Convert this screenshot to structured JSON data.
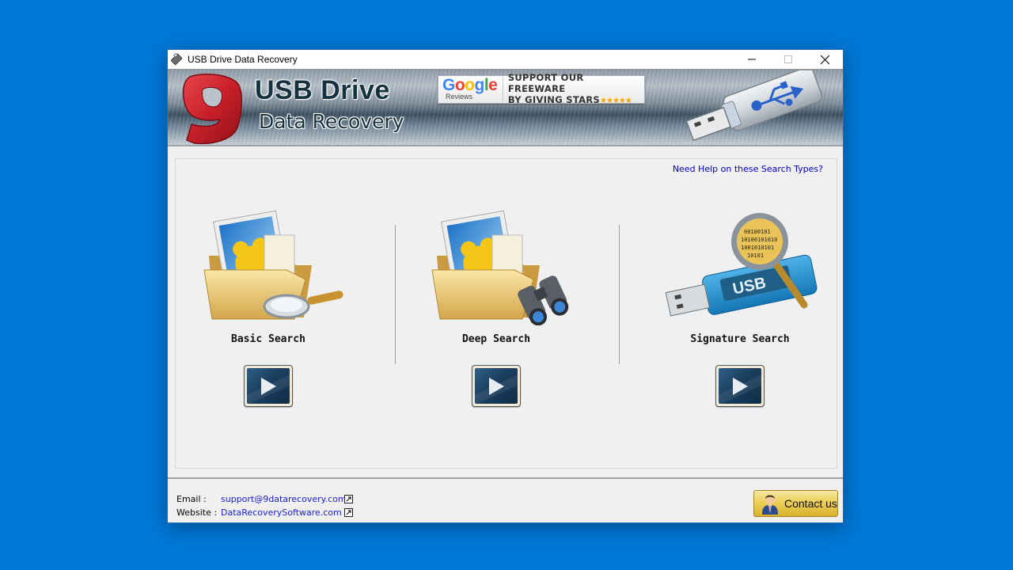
{
  "window": {
    "title": "USB Drive Data Recovery",
    "controls": [
      "minimize",
      "maximize",
      "close"
    ]
  },
  "banner": {
    "logo_glyph": "9",
    "title_line1": "USB Drive",
    "title_line2": "Data Recovery",
    "google_badge": {
      "brand": "Google",
      "brand_sub": "Reviews",
      "line1": "SUPPORT OUR FREEWARE",
      "line2": "BY GIVING STARS",
      "stars": "★★★★★",
      "brand_colors": [
        "#4285f4",
        "#ea4335",
        "#fbbc05",
        "#4285f4",
        "#34a853",
        "#ea4335"
      ]
    }
  },
  "main": {
    "help_link": "Need Help on these Search Types?",
    "options": [
      {
        "label": "Basic Search",
        "icon": "folder-magnifier-icon"
      },
      {
        "label": "Deep Search",
        "icon": "folder-binoculars-icon"
      },
      {
        "label": "Signature Search",
        "icon": "usb-magnifier-icon"
      }
    ]
  },
  "footer": {
    "email_label": "Email :",
    "email_value": "support@9datarecovery.com",
    "website_label": "Website :",
    "website_value": "DataRecoverySoftware.com",
    "contact_button": "Contact us"
  },
  "colors": {
    "desktop": "#0078d7",
    "link": "#1a1adc",
    "help_link": "#0000cc",
    "logo_red": "#c8202a"
  }
}
